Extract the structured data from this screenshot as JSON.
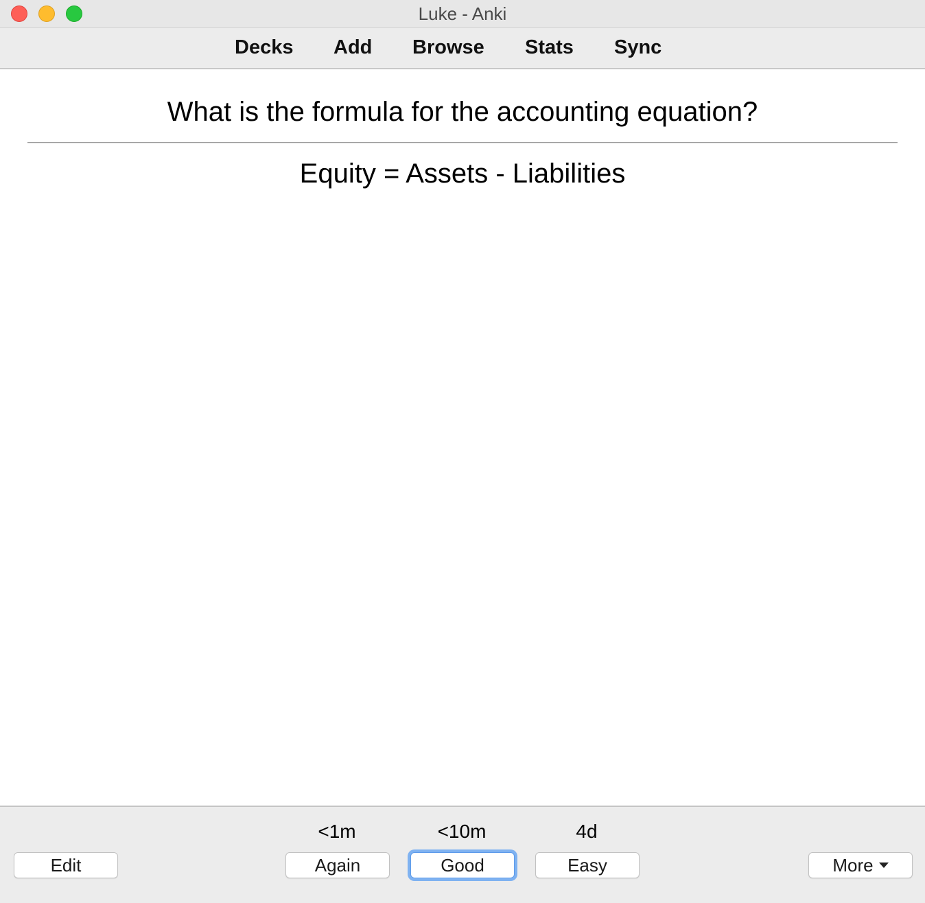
{
  "window": {
    "title": "Luke - Anki"
  },
  "toolbar": {
    "items": [
      {
        "label": "Decks"
      },
      {
        "label": "Add"
      },
      {
        "label": "Browse"
      },
      {
        "label": "Stats"
      },
      {
        "label": "Sync"
      }
    ]
  },
  "card": {
    "question": "What is the formula for the accounting equation?",
    "answer": "Equity = Assets - Liabilities"
  },
  "bottom": {
    "edit_label": "Edit",
    "more_label": "More",
    "more_icon": "chevron-down-icon",
    "answers": [
      {
        "label": "Again",
        "due": "<1m"
      },
      {
        "label": "Good",
        "due": "<10m",
        "focused": true
      },
      {
        "label": "Easy",
        "due": "4d"
      }
    ]
  },
  "colors": {
    "close": "#fe5f57",
    "minimize": "#febc2e",
    "zoom": "#28c840",
    "focus_ring": "#7fb2f1"
  }
}
